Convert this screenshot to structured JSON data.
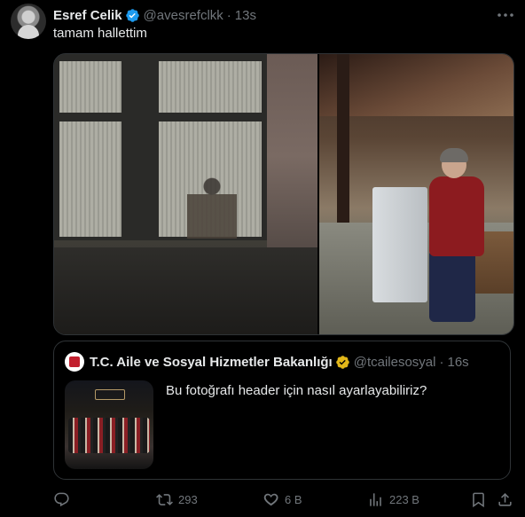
{
  "tweet": {
    "display_name": "Esref Celik",
    "handle": "@avesrefclkk",
    "separator": "·",
    "time": "13s",
    "text": "tamam hallettim",
    "media": [
      {
        "description_icon": "photo-window-night"
      },
      {
        "description_icon": "photo-woman-bench"
      }
    ]
  },
  "quoted_tweet": {
    "display_name": "T.C. Aile ve Sosyal Hizmetler Bakanlığı",
    "handle": "@tcailesosyal",
    "separator": "·",
    "time": "16s",
    "text": "Bu fotoğrafı header için nasıl ayarlayabiliriz?"
  },
  "actions": {
    "reply_count": "",
    "retweet_count": "293",
    "like_count": "6 B",
    "views_count": "223 B"
  },
  "colors": {
    "background": "#000000",
    "text_primary": "#e7e9ea",
    "text_secondary": "#71767b",
    "border": "#2f3336",
    "verified_blue": "#1d9bf0",
    "verified_gold": "#e2b719"
  }
}
